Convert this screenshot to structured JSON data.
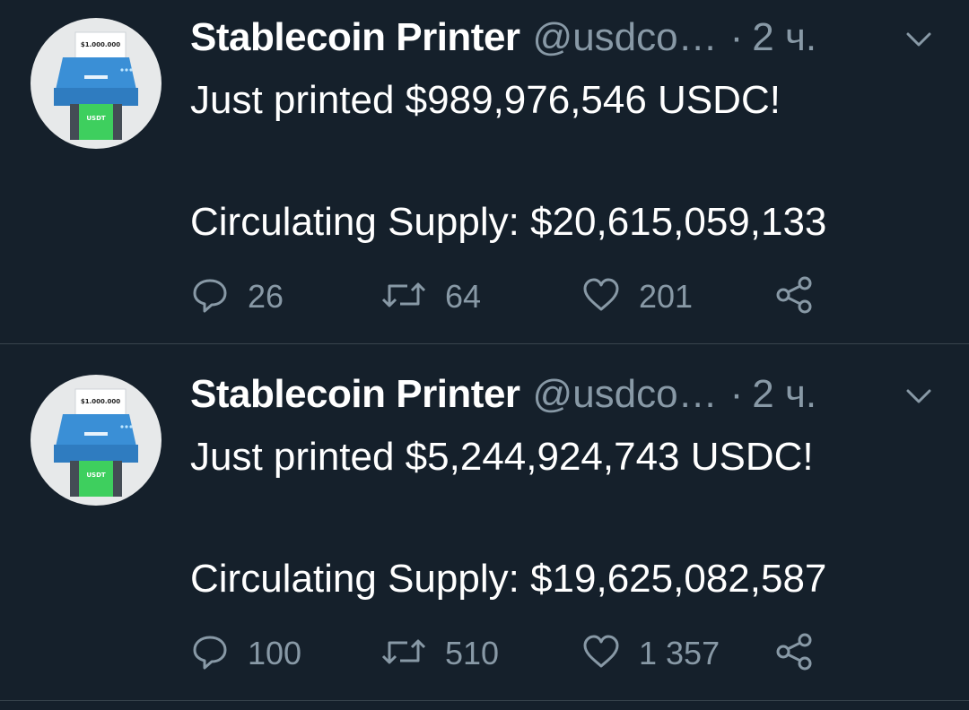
{
  "colors": {
    "background": "#15202b",
    "text_primary": "#ffffff",
    "text_secondary": "#8899a6",
    "divider": "#38444d",
    "printer_blue": "#3a8fd6",
    "printer_green": "#3ecf5e"
  },
  "tweets": [
    {
      "author_name": "Stablecoin Printer",
      "handle": "@usdco…",
      "separator": "·",
      "time": "2 ч.",
      "line1": "Just printed $989,976,546 USDC!",
      "line2": "Circulating Supply: $20,615,059,133",
      "avatar": {
        "paper_text": "$1.000.000",
        "money_text": "USDT"
      },
      "replies": "26",
      "retweets": "64",
      "likes": "201",
      "icons": [
        "reply-icon",
        "retweet-icon",
        "like-icon",
        "share-icon",
        "chevron-down-icon"
      ]
    },
    {
      "author_name": "Stablecoin Printer",
      "handle": "@usdco…",
      "separator": "·",
      "time": "2 ч.",
      "line1": "Just printed $5,244,924,743 USDC!",
      "line2": "Circulating Supply: $19,625,082,587",
      "avatar": {
        "paper_text": "$1.000.000",
        "money_text": "USDT"
      },
      "replies": "100",
      "retweets": "510",
      "likes": "1 357",
      "icons": [
        "reply-icon",
        "retweet-icon",
        "like-icon",
        "share-icon",
        "chevron-down-icon"
      ]
    }
  ]
}
